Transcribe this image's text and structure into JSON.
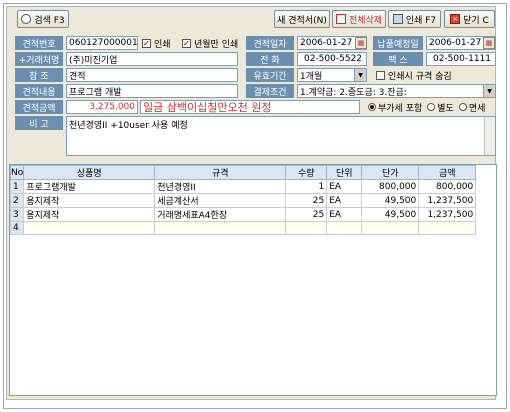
{
  "toolbar": {
    "search_label": "검색 F3",
    "new_quote_label": "새 견적서(N)",
    "delete_all_label": "전체삭제",
    "print_label": "인쇄 F7",
    "close_label": "닫기 C"
  },
  "form": {
    "quote_no_label": "견적번호",
    "quote_no_value": "060127000001",
    "print_check_label": "인쇄",
    "year_month_print_label": "년월만 인쇄",
    "quote_date_label": "견적일자",
    "quote_date_value": "2006-01-27",
    "delivery_date_label": "납품예정일",
    "delivery_date_value": "2006-01-27",
    "client_label": "+거래처명",
    "client_value": "(주)미진기업",
    "phone_label": "전     화",
    "phone_value": "02-500-5522",
    "fax_label": "팩     스",
    "fax_value": "02-500-1111",
    "reference_label": "참     조",
    "reference_value": "견적",
    "validity_label": "유효기간",
    "validity_value": "1개월",
    "hide_spec_label": "인쇄시 규격 숨김",
    "content_label": "견적내용",
    "content_value": "프로그램 개발",
    "payment_label": "결제조건",
    "payment_value": "1.계약금: 2.중도금: 3.잔금:",
    "amount_label": "견적금액",
    "amount_value": "3,275,000",
    "amount_korean": "일금 삼백이십칠만오천 원정",
    "vat_included_label": "부가세 포함",
    "vat_separate_label": "별도",
    "vat_exempt_label": "면세",
    "remarks_label": "비     고",
    "remarks_value": "천년경영II +10user 사용 예정"
  },
  "table": {
    "headers": [
      "No",
      "상품명",
      "규격",
      "수량",
      "단위",
      "단가",
      "금액"
    ],
    "rows": [
      {
        "no": "1",
        "name": "프로그램개발",
        "spec": "천년경영II",
        "qty": "1",
        "unit": "EA",
        "price": "800,000",
        "amount": "800,000"
      },
      {
        "no": "2",
        "name": "용지제작",
        "spec": "세금계산서",
        "qty": "25",
        "unit": "EA",
        "price": "49,500",
        "amount": "1,237,500"
      },
      {
        "no": "3",
        "name": "용지제작",
        "spec": "거래명세표A4한장",
        "qty": "25",
        "unit": "EA",
        "price": "49,500",
        "amount": "1,237,500"
      },
      {
        "no": "4",
        "name": "",
        "spec": "",
        "qty": "",
        "unit": "",
        "price": "",
        "amount": ""
      }
    ]
  },
  "colors": {
    "label_bg": "#6c8fb0",
    "window_bg": "#ece9d8",
    "amount_text": "#d03030",
    "header_bg": "#dbe6f2"
  }
}
